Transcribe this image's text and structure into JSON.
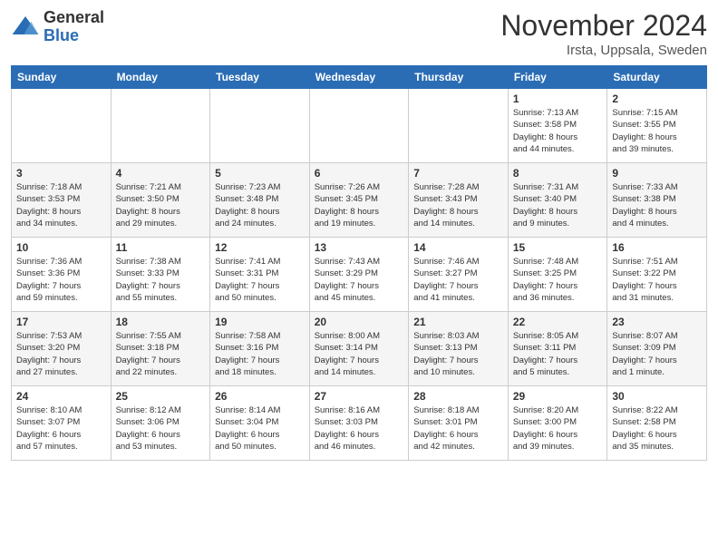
{
  "logo": {
    "general": "General",
    "blue": "Blue"
  },
  "title": "November 2024",
  "location": "Irsta, Uppsala, Sweden",
  "weekdays": [
    "Sunday",
    "Monday",
    "Tuesday",
    "Wednesday",
    "Thursday",
    "Friday",
    "Saturday"
  ],
  "weeks": [
    [
      {
        "day": "",
        "info": ""
      },
      {
        "day": "",
        "info": ""
      },
      {
        "day": "",
        "info": ""
      },
      {
        "day": "",
        "info": ""
      },
      {
        "day": "",
        "info": ""
      },
      {
        "day": "1",
        "info": "Sunrise: 7:13 AM\nSunset: 3:58 PM\nDaylight: 8 hours\nand 44 minutes."
      },
      {
        "day": "2",
        "info": "Sunrise: 7:15 AM\nSunset: 3:55 PM\nDaylight: 8 hours\nand 39 minutes."
      }
    ],
    [
      {
        "day": "3",
        "info": "Sunrise: 7:18 AM\nSunset: 3:53 PM\nDaylight: 8 hours\nand 34 minutes."
      },
      {
        "day": "4",
        "info": "Sunrise: 7:21 AM\nSunset: 3:50 PM\nDaylight: 8 hours\nand 29 minutes."
      },
      {
        "day": "5",
        "info": "Sunrise: 7:23 AM\nSunset: 3:48 PM\nDaylight: 8 hours\nand 24 minutes."
      },
      {
        "day": "6",
        "info": "Sunrise: 7:26 AM\nSunset: 3:45 PM\nDaylight: 8 hours\nand 19 minutes."
      },
      {
        "day": "7",
        "info": "Sunrise: 7:28 AM\nSunset: 3:43 PM\nDaylight: 8 hours\nand 14 minutes."
      },
      {
        "day": "8",
        "info": "Sunrise: 7:31 AM\nSunset: 3:40 PM\nDaylight: 8 hours\nand 9 minutes."
      },
      {
        "day": "9",
        "info": "Sunrise: 7:33 AM\nSunset: 3:38 PM\nDaylight: 8 hours\nand 4 minutes."
      }
    ],
    [
      {
        "day": "10",
        "info": "Sunrise: 7:36 AM\nSunset: 3:36 PM\nDaylight: 7 hours\nand 59 minutes."
      },
      {
        "day": "11",
        "info": "Sunrise: 7:38 AM\nSunset: 3:33 PM\nDaylight: 7 hours\nand 55 minutes."
      },
      {
        "day": "12",
        "info": "Sunrise: 7:41 AM\nSunset: 3:31 PM\nDaylight: 7 hours\nand 50 minutes."
      },
      {
        "day": "13",
        "info": "Sunrise: 7:43 AM\nSunset: 3:29 PM\nDaylight: 7 hours\nand 45 minutes."
      },
      {
        "day": "14",
        "info": "Sunrise: 7:46 AM\nSunset: 3:27 PM\nDaylight: 7 hours\nand 41 minutes."
      },
      {
        "day": "15",
        "info": "Sunrise: 7:48 AM\nSunset: 3:25 PM\nDaylight: 7 hours\nand 36 minutes."
      },
      {
        "day": "16",
        "info": "Sunrise: 7:51 AM\nSunset: 3:22 PM\nDaylight: 7 hours\nand 31 minutes."
      }
    ],
    [
      {
        "day": "17",
        "info": "Sunrise: 7:53 AM\nSunset: 3:20 PM\nDaylight: 7 hours\nand 27 minutes."
      },
      {
        "day": "18",
        "info": "Sunrise: 7:55 AM\nSunset: 3:18 PM\nDaylight: 7 hours\nand 22 minutes."
      },
      {
        "day": "19",
        "info": "Sunrise: 7:58 AM\nSunset: 3:16 PM\nDaylight: 7 hours\nand 18 minutes."
      },
      {
        "day": "20",
        "info": "Sunrise: 8:00 AM\nSunset: 3:14 PM\nDaylight: 7 hours\nand 14 minutes."
      },
      {
        "day": "21",
        "info": "Sunrise: 8:03 AM\nSunset: 3:13 PM\nDaylight: 7 hours\nand 10 minutes."
      },
      {
        "day": "22",
        "info": "Sunrise: 8:05 AM\nSunset: 3:11 PM\nDaylight: 7 hours\nand 5 minutes."
      },
      {
        "day": "23",
        "info": "Sunrise: 8:07 AM\nSunset: 3:09 PM\nDaylight: 7 hours\nand 1 minute."
      }
    ],
    [
      {
        "day": "24",
        "info": "Sunrise: 8:10 AM\nSunset: 3:07 PM\nDaylight: 6 hours\nand 57 minutes."
      },
      {
        "day": "25",
        "info": "Sunrise: 8:12 AM\nSunset: 3:06 PM\nDaylight: 6 hours\nand 53 minutes."
      },
      {
        "day": "26",
        "info": "Sunrise: 8:14 AM\nSunset: 3:04 PM\nDaylight: 6 hours\nand 50 minutes."
      },
      {
        "day": "27",
        "info": "Sunrise: 8:16 AM\nSunset: 3:03 PM\nDaylight: 6 hours\nand 46 minutes."
      },
      {
        "day": "28",
        "info": "Sunrise: 8:18 AM\nSunset: 3:01 PM\nDaylight: 6 hours\nand 42 minutes."
      },
      {
        "day": "29",
        "info": "Sunrise: 8:20 AM\nSunset: 3:00 PM\nDaylight: 6 hours\nand 39 minutes."
      },
      {
        "day": "30",
        "info": "Sunrise: 8:22 AM\nSunset: 2:58 PM\nDaylight: 6 hours\nand 35 minutes."
      }
    ]
  ]
}
